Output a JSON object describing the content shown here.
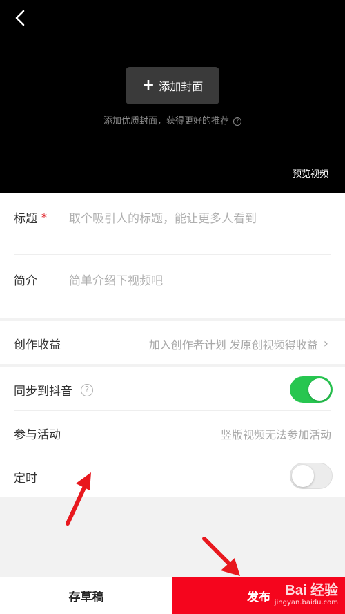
{
  "cover": {
    "add_cover_label": "添加封面",
    "hint": "添加优质封面，获得更好的推荐",
    "preview_label": "预览视频"
  },
  "form": {
    "title_label": "标题",
    "title_required_mark": "*",
    "title_placeholder": "取个吸引人的标题，能让更多人看到",
    "intro_label": "简介",
    "intro_placeholder": "简单介绍下视频吧"
  },
  "income": {
    "label": "创作收益",
    "value": "加入创作者计划 发原创视频得收益"
  },
  "settings": {
    "sync_label": "同步到抖音",
    "sync_on": true,
    "event_label": "参与活动",
    "event_value": "竖版视频无法参加活动",
    "timer_label": "定时",
    "timer_on": false
  },
  "bottom_bar": {
    "draft_label": "存草稿",
    "publish_label": "发布"
  },
  "watermark": {
    "text": "Bai 经验",
    "url": "jingyan.baidu.com"
  },
  "colors": {
    "publish_red": "#f5051d",
    "toggle_green": "#27c650",
    "annotation_red": "#e8181e",
    "required_red": "#e0242a"
  }
}
